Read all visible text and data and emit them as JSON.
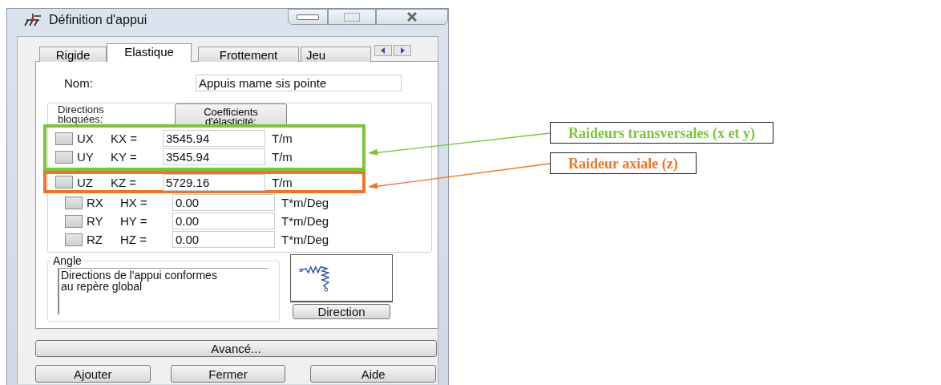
{
  "window": {
    "title": "Définition d'appui"
  },
  "tabs": [
    {
      "label": "Rigide",
      "selected": false
    },
    {
      "label": "Elastique",
      "selected": true
    },
    {
      "label": "Frottement",
      "selected": false
    },
    {
      "label": "Jeu",
      "selected": false
    }
  ],
  "name_field": {
    "label": "Nom:",
    "value": "Appuis mame sis pointe"
  },
  "directions": {
    "label": "Directions bloquées:",
    "coefficients_button": "Coefficients d'élasticité:",
    "rows": [
      {
        "dof": "UX",
        "coefficient": "KX =",
        "value": "3545.94",
        "unit": "T/m",
        "checked": false
      },
      {
        "dof": "UY",
        "coefficient": "KY =",
        "value": "3545.94",
        "unit": "T/m",
        "checked": false
      },
      {
        "dof": "UZ",
        "coefficient": "KZ =",
        "value": "5729.16",
        "unit": "T/m",
        "checked": false
      },
      {
        "dof": "RX",
        "coefficient": "HX =",
        "value": "0.00",
        "unit": "T*m/Deg",
        "checked": false
      },
      {
        "dof": "RY",
        "coefficient": "HY =",
        "value": "0.00",
        "unit": "T*m/Deg",
        "checked": false
      },
      {
        "dof": "RZ",
        "coefficient": "HZ =",
        "value": "0.00",
        "unit": "T*m/Deg",
        "checked": false
      }
    ]
  },
  "angle": {
    "legend": "Angle",
    "text": "Directions de l'appui conformes au repère global",
    "direction_button": "Direction"
  },
  "buttons": {
    "advanced": "Avancé...",
    "actions": [
      "Ajouter",
      "Fermer",
      "Aide"
    ]
  },
  "annotations": [
    {
      "text": "Raideurs transversales (x et y)",
      "color": "#7cc43a"
    },
    {
      "text": "Raideur axiale (z)",
      "color": "#f07428"
    }
  ]
}
